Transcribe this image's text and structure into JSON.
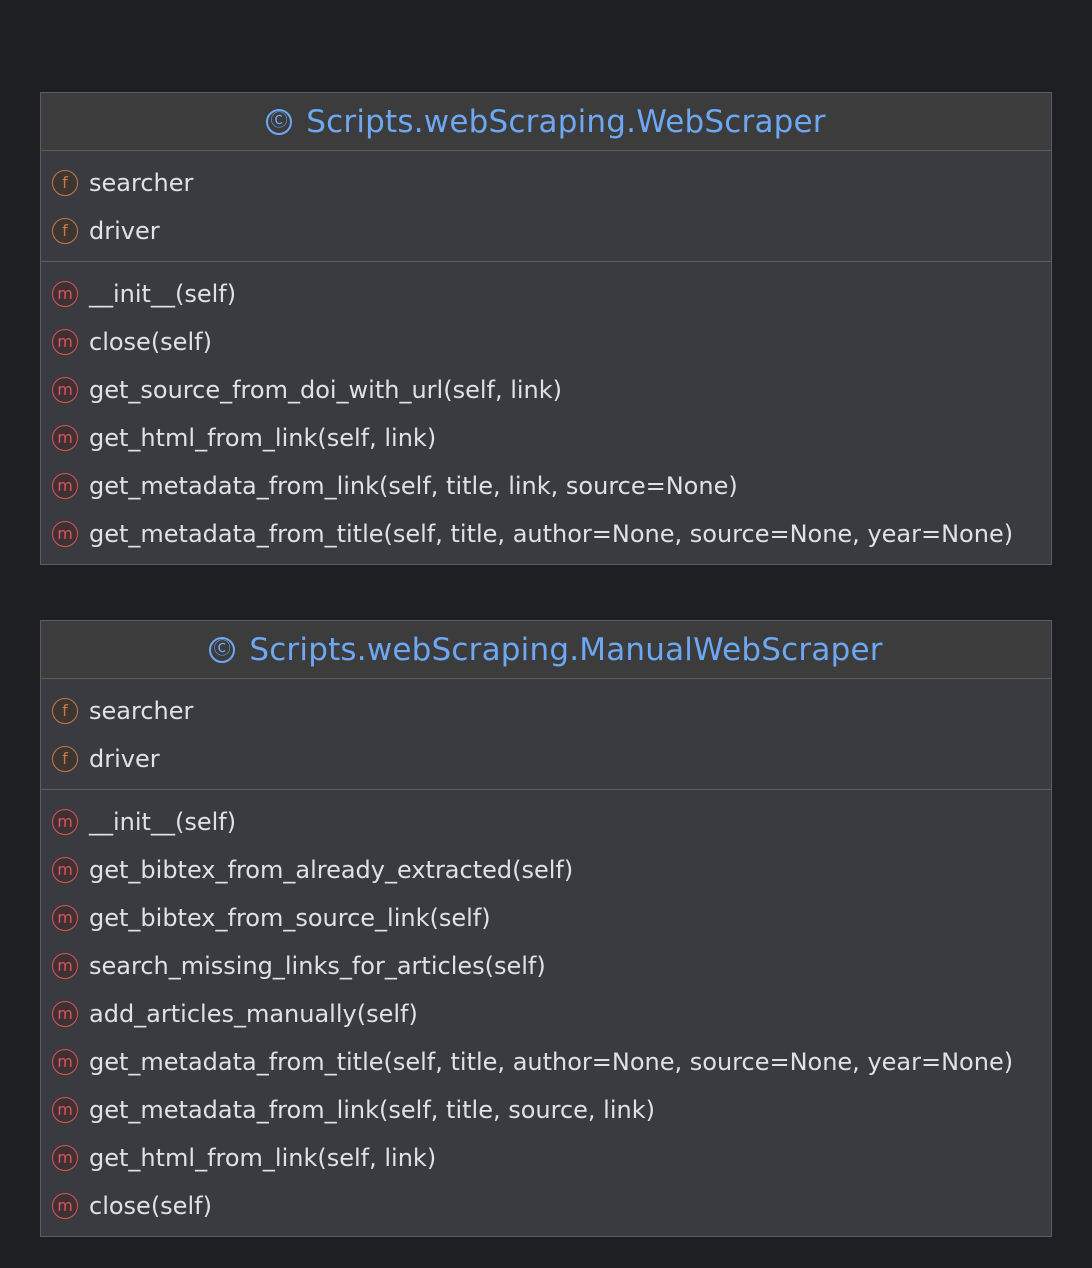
{
  "classes": [
    {
      "name": "Scripts.webScraping.WebScraper",
      "class_icon": "Ⓒ",
      "fields": [
        {
          "icon": "f",
          "label": "searcher"
        },
        {
          "icon": "f",
          "label": "driver"
        }
      ],
      "methods": [
        {
          "icon": "m",
          "label": "__init__(self)"
        },
        {
          "icon": "m",
          "label": "close(self)"
        },
        {
          "icon": "m",
          "label": "get_source_from_doi_with_url(self, link)"
        },
        {
          "icon": "m",
          "label": "get_html_from_link(self, link)"
        },
        {
          "icon": "m",
          "label": "get_metadata_from_link(self, title, link, source=None)"
        },
        {
          "icon": "m",
          "label": "get_metadata_from_title(self, title, author=None, source=None, year=None)"
        }
      ]
    },
    {
      "name": "Scripts.webScraping.ManualWebScraper",
      "class_icon": "Ⓒ",
      "fields": [
        {
          "icon": "f",
          "label": "searcher"
        },
        {
          "icon": "f",
          "label": "driver"
        }
      ],
      "methods": [
        {
          "icon": "m",
          "label": "__init__(self)"
        },
        {
          "icon": "m",
          "label": "get_bibtex_from_already_extracted(self)"
        },
        {
          "icon": "m",
          "label": "get_bibtex_from_source_link(self)"
        },
        {
          "icon": "m",
          "label": "search_missing_links_for_articles(self)"
        },
        {
          "icon": "m",
          "label": "add_articles_manually(self)"
        },
        {
          "icon": "m",
          "label": "get_metadata_from_title(self, title, author=None, source=None, year=None)"
        },
        {
          "icon": "m",
          "label": "get_metadata_from_link(self, title, source, link)"
        },
        {
          "icon": "m",
          "label": "get_html_from_link(self, link)"
        },
        {
          "icon": "m",
          "label": "close(self)"
        }
      ]
    }
  ],
  "colors": {
    "background": "#1e1f22",
    "box": "#393b40",
    "header": "#3c3c3c",
    "border": "#5a5d63",
    "class_name": "#6ea7f2",
    "text": "#dfe1e5",
    "field_badge": "#c7794b",
    "method_badge": "#d8545a"
  }
}
